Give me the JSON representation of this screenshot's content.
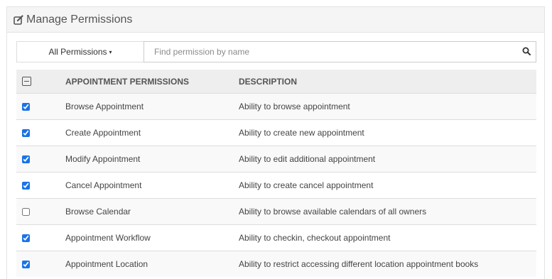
{
  "panel": {
    "title": "Manage Permissions",
    "icon": "edit-icon"
  },
  "filter": {
    "label": "All Permissions",
    "caret": "▾"
  },
  "search": {
    "placeholder": "Find permission by name",
    "value": "",
    "icon": "search-icon"
  },
  "table": {
    "headers": {
      "select_all": "minus-checkbox",
      "name": "APPOINTMENT PERMISSIONS",
      "description": "DESCRIPTION"
    },
    "rows": [
      {
        "name": "Browse Appointment",
        "description": "Ability to browse appointment",
        "checked": true
      },
      {
        "name": "Create Appointment",
        "description": "Ability to create new appointment",
        "checked": true
      },
      {
        "name": "Modify Appointment",
        "description": "Ability to edit additional appointment",
        "checked": true
      },
      {
        "name": "Cancel Appointment",
        "description": "Ability to create cancel appointment",
        "checked": true
      },
      {
        "name": "Browse Calendar",
        "description": "Ability to browse available calendars of all owners",
        "checked": false
      },
      {
        "name": "Appointment Workflow",
        "description": "Ability to checkin, checkout appointment",
        "checked": true
      },
      {
        "name": "Appointment Location",
        "description": "Ability to restrict accessing different location appointment books",
        "checked": true
      }
    ]
  },
  "colors": {
    "accent": "#1a73e8",
    "header_bg": "#f5f5f5",
    "table_header_bg": "#eeeeee",
    "stripe_bg": "#f9f9f9"
  }
}
